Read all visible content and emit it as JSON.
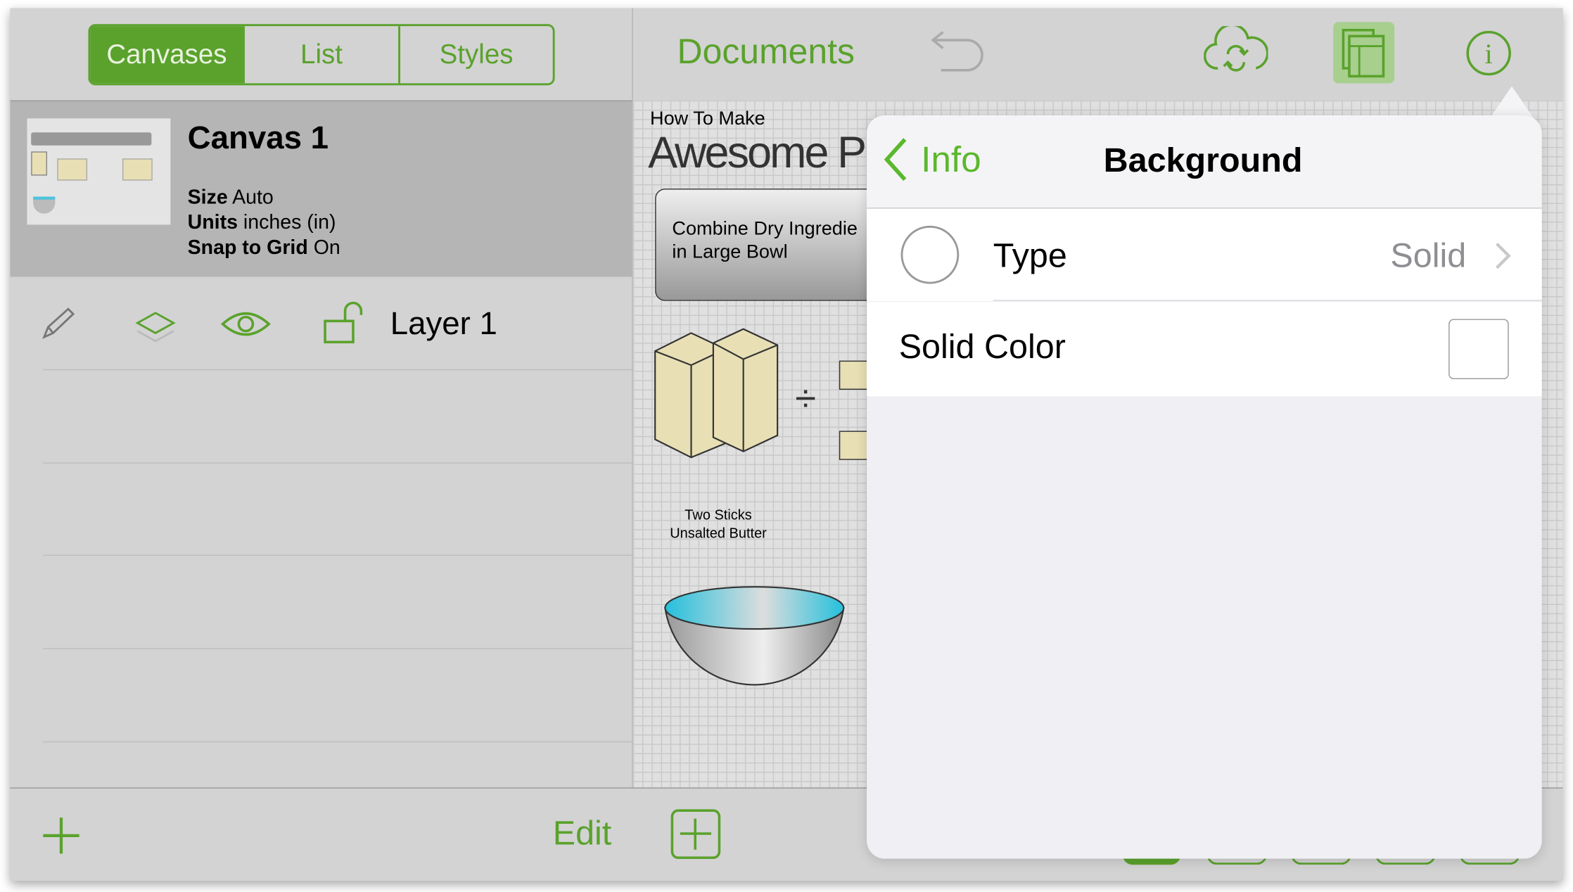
{
  "segments": [
    "Canvases",
    "List",
    "Styles"
  ],
  "header": {
    "title": "Documents"
  },
  "canvas": {
    "name": "Canvas 1",
    "size_label": "Size",
    "size": "Auto",
    "units_label": "Units",
    "units": "inches (in)",
    "snap_label": "Snap to Grid",
    "snap": "On"
  },
  "layer": {
    "name": "Layer 1"
  },
  "footer": {
    "edit": "Edit"
  },
  "diagram": {
    "line1": "How To Make",
    "line2": "Awesome P",
    "box": "Combine Dry Ingredie\nin Large Bowl",
    "box1": "Combine Dry Ingredie",
    "box2": "in Large Bowl",
    "caption1": "Two Sticks",
    "caption2": "Unsalted Butter"
  },
  "popover": {
    "back": "Info",
    "title": "Background",
    "type_label": "Type",
    "type_value": "Solid",
    "solid_color_label": "Solid Color"
  },
  "colors": {
    "accent": "#5aa22c"
  }
}
